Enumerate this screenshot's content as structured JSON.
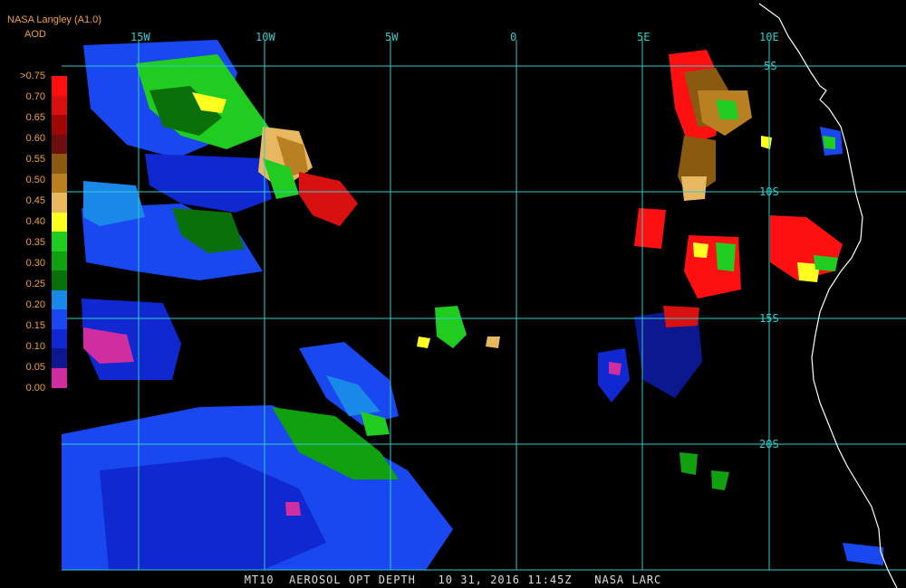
{
  "header": {
    "title": "NASA Langley (A1.0)",
    "units": "AOD"
  },
  "map": {
    "lon_labels": [
      "15W",
      "10W",
      "5W",
      "0",
      "5E",
      "10E"
    ],
    "lat_labels": [
      "5S",
      "10S",
      "15S",
      "20S"
    ]
  },
  "colorbar": {
    "ticks": [
      ">0.75",
      "0.70",
      "0.65",
      "0.60",
      "0.55",
      "0.50",
      "0.45",
      "0.40",
      "0.35",
      "0.30",
      "0.25",
      "0.20",
      "0.15",
      "0.10",
      "0.05",
      "0.00"
    ],
    "colors": [
      "#ff1010",
      "#d81010",
      "#a00808",
      "#6e0f0f",
      "#8a5a10",
      "#b88020",
      "#e8b860",
      "#ffff20",
      "#20cc20",
      "#10a010",
      "#0a700a",
      "#1a88e8",
      "#1a48f0",
      "#1028d0",
      "#0c1890",
      "#d02ea0"
    ]
  },
  "footer": {
    "caption": "MT10  AEROSOL OPT DEPTH   10 31, 2016 11:45Z   NASA LARC"
  }
}
